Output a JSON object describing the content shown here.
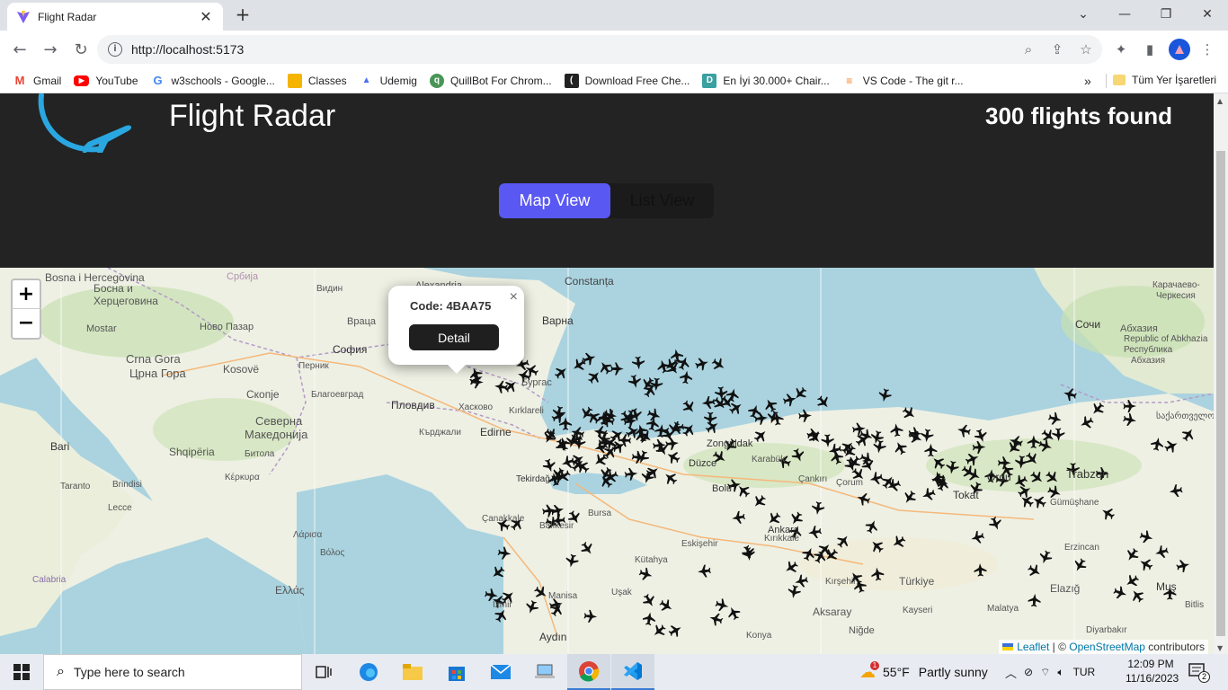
{
  "browser": {
    "tab_title": "Flight Radar",
    "url": "http://localhost:5173",
    "bookmarks": [
      {
        "label": "Gmail",
        "icon": "gmail-icon",
        "color": "#ea4335"
      },
      {
        "label": "YouTube",
        "icon": "youtube-icon",
        "color": "#ff0000"
      },
      {
        "label": "w3schools - Google...",
        "icon": "google-icon",
        "color": "#4285f4"
      },
      {
        "label": "Classes",
        "icon": "classroom-icon",
        "color": "#f4b400"
      },
      {
        "label": "Udemig",
        "icon": "udemig-icon",
        "color": "#4a6cf7"
      },
      {
        "label": "QuillBot For Chrom...",
        "icon": "quillbot-icon",
        "color": "#499557"
      },
      {
        "label": "Download Free Che...",
        "icon": "cheatsheet-icon",
        "color": "#222222"
      },
      {
        "label": "En İyi 30.000+ Chair...",
        "icon": "d-icon",
        "color": "#3aa0a0"
      },
      {
        "label": "VS Code - The git r...",
        "icon": "stackoverflow-icon",
        "color": "#f48024"
      }
    ],
    "bookmarks_overflow": "»",
    "all_bookmarks": "Tüm Yer İşaretleri"
  },
  "app": {
    "title": "Flight Radar",
    "flights_found": "300 flights found",
    "view_toggle": {
      "map": "Map View",
      "list": "List View",
      "active": "map"
    },
    "popup": {
      "code": "Code: 4BAA75",
      "button": "Detail",
      "close": "×"
    },
    "zoom": {
      "in": "+",
      "out": "−"
    },
    "attribution": {
      "leaflet": "Leaflet",
      "separator": " | © ",
      "osm": "OpenStreetMap",
      "suffix": " contributors"
    },
    "colors": {
      "header_bg": "#232323",
      "accent": "#5a58f2",
      "sea": "#aad3df",
      "land": "#eef0e4"
    }
  },
  "map_labels": [
    {
      "text": "Bosna i Hercegovina"
    },
    {
      "text": "Босна и"
    },
    {
      "text": "Херцеговина"
    },
    {
      "text": "Србија"
    },
    {
      "text": "Alexandria"
    },
    {
      "text": "Constanța"
    },
    {
      "text": "Видин"
    },
    {
      "text": "Ново Пазар"
    },
    {
      "text": "Враца"
    },
    {
      "text": "Варна"
    },
    {
      "text": "Mostar"
    },
    {
      "text": "София"
    },
    {
      "text": "Crna Gora"
    },
    {
      "text": "Црна Гора"
    },
    {
      "text": "Kosovë"
    },
    {
      "text": "Перник"
    },
    {
      "text": "Бургас"
    },
    {
      "text": "Скопје"
    },
    {
      "text": "Благоевград"
    },
    {
      "text": "Пловдив"
    },
    {
      "text": "Хасково"
    },
    {
      "text": "Kırklareli"
    },
    {
      "text": "Северна"
    },
    {
      "text": "Македонија"
    },
    {
      "text": "Кърджали"
    },
    {
      "text": "Edirne"
    },
    {
      "text": "Bari"
    },
    {
      "text": "Shqipëria"
    },
    {
      "text": "Битола"
    },
    {
      "text": "Taranto"
    },
    {
      "text": "Brindisi"
    },
    {
      "text": "Lecce"
    },
    {
      "text": "Κέρκυρα"
    },
    {
      "text": "Λάρισα"
    },
    {
      "text": "Βόλος"
    },
    {
      "text": "Ελλάς"
    },
    {
      "text": "Calabria"
    },
    {
      "text": "Zonguldak"
    },
    {
      "text": "Karabük"
    },
    {
      "text": "Düzce"
    },
    {
      "text": "Çankırı"
    },
    {
      "text": "Çorum"
    },
    {
      "text": "Ordu"
    },
    {
      "text": "Trabzon"
    },
    {
      "text": "Tokat"
    },
    {
      "text": "Gümüşhane"
    },
    {
      "text": "Tekirdağ"
    },
    {
      "text": "Bursa"
    },
    {
      "text": "Çanakkale"
    },
    {
      "text": "Balıkesir"
    },
    {
      "text": "Eskişehir"
    },
    {
      "text": "Kütahya"
    },
    {
      "text": "Kırıkkale"
    },
    {
      "text": "Kırşehir"
    },
    {
      "text": "Türkiye"
    },
    {
      "text": "Elazığ"
    },
    {
      "text": "Erzincan"
    },
    {
      "text": "Uşak"
    },
    {
      "text": "Manisa"
    },
    {
      "text": "İzmir"
    },
    {
      "text": "Aydın"
    },
    {
      "text": "Aksaray"
    },
    {
      "text": "Niğde"
    },
    {
      "text": "Kayseri"
    },
    {
      "text": "Malatya"
    },
    {
      "text": "Konya"
    },
    {
      "text": "Muş"
    },
    {
      "text": "Bitlis"
    },
    {
      "text": "Diyarbakır"
    },
    {
      "text": "Сочи"
    },
    {
      "text": "Карачаево-"
    },
    {
      "text": "Черкесия"
    },
    {
      "text": "Абхазия"
    },
    {
      "text": "Republic of Abkhazia"
    },
    {
      "text": "Абхазия"
    },
    {
      "text": "Республика"
    },
    {
      "text": "საქართველო"
    },
    {
      "text": "Ankara"
    },
    {
      "text": "Bolu"
    }
  ],
  "taskbar": {
    "search_placeholder": "Type here to search",
    "weather_temp": "55°F",
    "weather_text": "Partly sunny",
    "weather_badge": "1",
    "language": "TUR",
    "time": "12:09 PM",
    "date": "11/16/2023",
    "notifications": "2"
  }
}
